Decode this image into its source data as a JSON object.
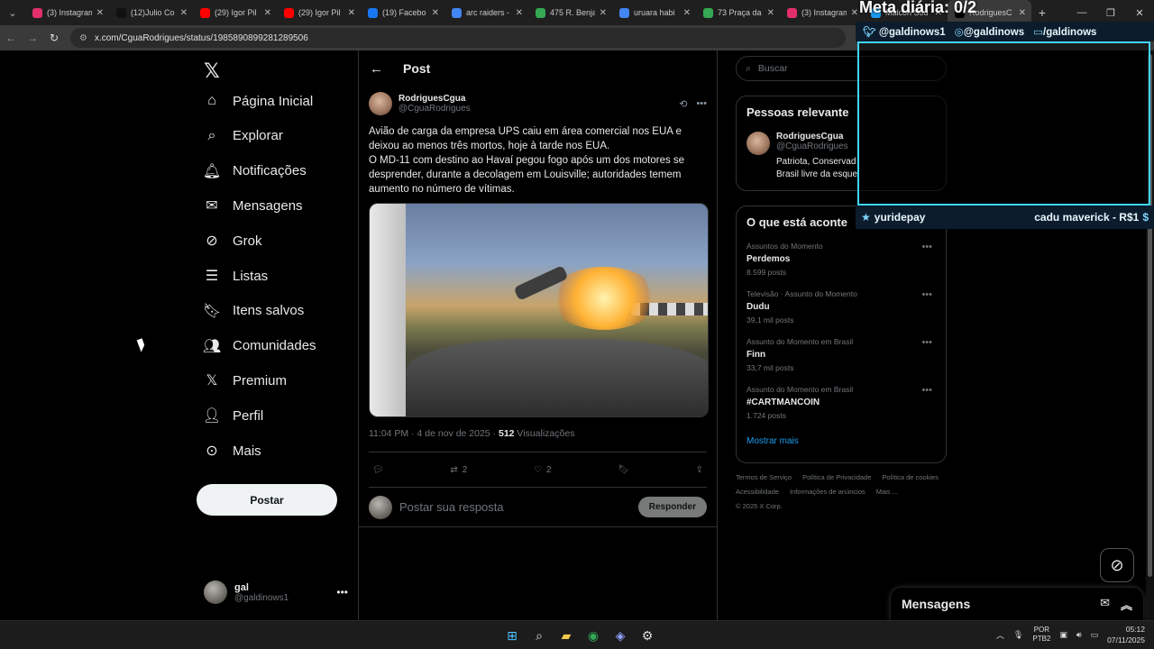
{
  "browser": {
    "tabs": [
      {
        "label": "(3) Instagram",
        "color": "#e1306c"
      },
      {
        "label": "(12)Julio Co",
        "color": "#111111"
      },
      {
        "label": "(29) Igor Pil",
        "color": "#ff0000"
      },
      {
        "label": "(29) Igor Pil",
        "color": "#ff0000"
      },
      {
        "label": "(19) Facebo",
        "color": "#1877f2"
      },
      {
        "label": "arc raiders -",
        "color": "#4285f4"
      },
      {
        "label": "475 R. Benja",
        "color": "#34a853"
      },
      {
        "label": "uruara habi",
        "color": "#4285f4"
      },
      {
        "label": "73 Praça da",
        "color": "#34a853"
      },
      {
        "label": "(3) Instagram",
        "color": "#e1306c"
      },
      {
        "label": "Malcon Sou",
        "color": "#1d9bf0"
      },
      {
        "label": "RodriguesC",
        "color": "#000000"
      }
    ],
    "url": "x.com/CguaRodrigues/status/1985890899281289506"
  },
  "nav": {
    "items": [
      {
        "label": "Página Inicial",
        "icon": "home-icon"
      },
      {
        "label": "Explorar",
        "icon": "search-icon"
      },
      {
        "label": "Notificações",
        "icon": "bell-icon"
      },
      {
        "label": "Mensagens",
        "icon": "mail-icon"
      },
      {
        "label": "Grok",
        "icon": "grok-icon"
      },
      {
        "label": "Listas",
        "icon": "list-icon"
      },
      {
        "label": "Itens salvos",
        "icon": "bookmark-icon"
      },
      {
        "label": "Comunidades",
        "icon": "communities-icon"
      },
      {
        "label": "Premium",
        "icon": "x-icon"
      },
      {
        "label": "Perfil",
        "icon": "person-icon"
      },
      {
        "label": "Mais",
        "icon": "more-circle-icon"
      }
    ],
    "post_button": "Postar",
    "account": {
      "name": "gal",
      "handle": "@galdinows1"
    }
  },
  "main": {
    "header_title": "Post",
    "post": {
      "author_name": "RodriguesCgua",
      "author_handle": "@CguaRodrigues",
      "text": "Avião de carga da empresa UPS caiu em área comercial nos EUA e deixou ao menos três mortos, hoje à tarde nos EUA.\nO MD-11 com destino ao Havaí pegou fogo após um dos motores se desprender, durante a decolagem em Louisville; autoridades temem aumento no número de vítimas.",
      "time": "11:04 PM · 4 de nov de 2025 · ",
      "views": "512",
      "views_label": " Visualizações",
      "retweets": "2",
      "likes": "2"
    },
    "reply_placeholder": "Postar sua resposta",
    "reply_button": "Responder"
  },
  "sidebar": {
    "search_placeholder": "Buscar",
    "relevant_title": "Pessoas relevante",
    "relevant_user": {
      "name": "RodriguesCgua",
      "handle": "@CguaRodrigues",
      "bio": "Patriota, Conservad\nBrasil livre da esque"
    },
    "trends_title": "O que está aconte",
    "trends": [
      {
        "context": "Assuntos do Momento",
        "name": "Perdemos",
        "count": "8.599 posts"
      },
      {
        "context": "Televisão · Assunto do Momento",
        "name": "Dudu",
        "count": "39,1 mil posts"
      },
      {
        "context": "Assunto do Momento em Brasil",
        "name": "Finn",
        "count": "33,7 mil posts"
      },
      {
        "context": "Assunto do Momento em Brasil",
        "name": "#CARTMANCOIN",
        "count": "1.724 posts"
      }
    ],
    "show_more": "Mostrar mais",
    "footer": [
      "Termos de Serviço",
      "Política de Privacidade",
      "Política de cookies",
      "Acessibilidade",
      "Informações de anúncios",
      "Mais ...",
      "© 2025 X Corp."
    ]
  },
  "overlay": {
    "title": "Meta diária: 0/2",
    "twitter": "@galdinows1",
    "instagram": "@galdinows",
    "twitch": "/galdinows",
    "donor": "yuridepay",
    "donation": "cadu maverick - R$1"
  },
  "messages_drawer": "Mensagens",
  "taskbar": {
    "lang": "POR",
    "layout": "PTB2",
    "time": "05:12",
    "date": "07/11/2025"
  }
}
